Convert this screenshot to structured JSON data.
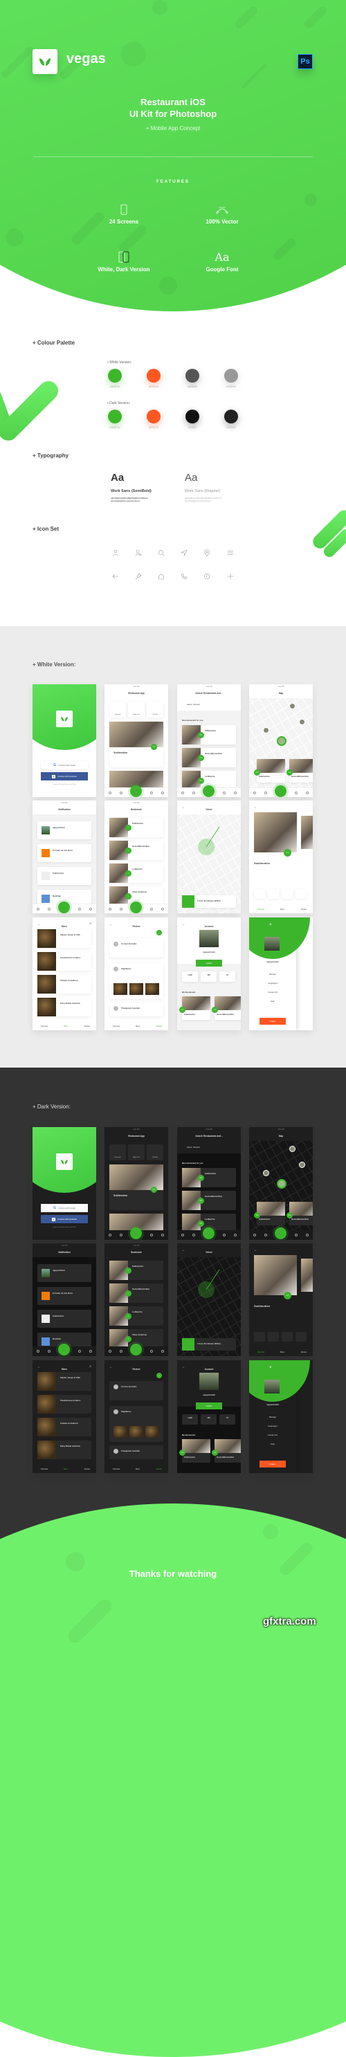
{
  "hero": {
    "brand_name": "vegas",
    "ps_badge": "Ps",
    "title_line1": "Restaurant iOS",
    "title_line2": "UI Kit for Photoshop",
    "subtitle": "+ Mobile App Concept",
    "features_label": "FEATURES",
    "features": [
      {
        "icon": "phone-icon",
        "label": "24 Screens"
      },
      {
        "icon": "vector-curve-icon",
        "label": "100% Vector"
      },
      {
        "icon": "dual-phone-icon",
        "label": "White, Dark Version"
      },
      {
        "icon": "font-icon",
        "label": "Google Font",
        "glyph": "Aa"
      }
    ]
  },
  "palette": {
    "title": "+ Colour Palette",
    "white_label": "• White Version:",
    "dark_label": "• Dark Version:",
    "white_colors": [
      "#3DB72A",
      "#FF5722",
      "#555555",
      "#999999"
    ],
    "dark_colors": [
      "#3DB72A",
      "#FF5722",
      "#111111",
      "#222222"
    ]
  },
  "typography": {
    "title": "+ Typography",
    "fonts": [
      {
        "sample": "Aa",
        "name": "Work Sans (SemiBold)",
        "upper": "ABCDEFGHIJKLMNOPQRSTUVWXYZ",
        "lower": "abcdefghijklmnopqrstuvwxyz"
      },
      {
        "sample": "Aa",
        "name": "Work Sans (Regular)",
        "upper": "ABCDEFGHIJKLMNOPQRSTUVWXYZ",
        "lower": "abcdefghijklmnopqrstuvwxyz"
      }
    ]
  },
  "icon_set": {
    "title": "+ Icon Set",
    "row1": [
      "user-icon",
      "user-settings-icon",
      "search-icon",
      "navigation-icon",
      "location-pin-icon",
      "menu-icon"
    ],
    "row2": [
      "back-arrow-icon",
      "pin-icon",
      "home-icon",
      "phone-call-icon",
      "clock-icon",
      "plus-icon"
    ]
  },
  "white_version": {
    "title": "+ White Version:",
    "screens": [
      {
        "title": "",
        "type": "login",
        "google": "Continue with Google",
        "facebook": "Continue with Facebook",
        "terms": "I agree to Privacy Policy and Terms"
      },
      {
        "title": "Restaurant App",
        "type": "home",
        "categories": [
          "Restaurant",
          "Coffee & Tea",
          "Club & Bar"
        ],
        "card_name": "Sublimotion",
        "rating": "4.2"
      },
      {
        "title": "Search Restaurants and...",
        "type": "search",
        "location": "Hanoi, Vietnam",
        "section": "Recommended for you",
        "items": [
          "Sublimotion",
          "HestonBlumenthal",
          "La Mascha"
        ]
      },
      {
        "title": "Map",
        "type": "map",
        "items": [
          "Sublimotion",
          "HestonBlumenthal"
        ]
      },
      {
        "title": "Notification",
        "type": "notification",
        "items": [
          "nguyenhnhdi",
          "El Celler de Can Roca",
          "Sublimotion",
          "RentSale"
        ]
      },
      {
        "title": "Bookmark",
        "type": "bookmark",
        "items": [
          "Sublimotion",
          "HestonBlumenthal",
          "La Mascha",
          "Vinas Undertow"
        ]
      },
      {
        "title": "Direct",
        "type": "direct",
        "eta": "1 hour 30 minutes (55km)"
      },
      {
        "title": "",
        "type": "detail",
        "name": "Sublimotion",
        "rating": "4.2",
        "tabs": [
          "Overview",
          "Menu",
          "Review"
        ]
      },
      {
        "title": "Menu",
        "type": "menu",
        "items": [
          "Salads, Soups & Chili",
          "Smokehouse Combos",
          "Chicken & Seafood",
          "Party Platter Add-Ons"
        ],
        "tabs": [
          "Overview",
          "Menu",
          "Review"
        ]
      },
      {
        "title": "Review",
        "type": "review",
        "items": [
          "Corona Australis",
          "Sagittarius",
          "Triangulum Australe"
        ],
        "tabs": [
          "Overview",
          "Menu",
          "Review"
        ]
      },
      {
        "title": "Account",
        "type": "account",
        "user": "nguyenhnhdi",
        "follow": "Follow",
        "stats": [
          "1,000",
          "100",
          "10"
        ],
        "section": "My Restaurant",
        "items": [
          "Sublimotion",
          "HestonBlumenthal"
        ]
      },
      {
        "title": "",
        "type": "drawer",
        "user": "nguyenhnhdi",
        "menu": [
          "Manage",
          "Languages",
          "Contact US",
          "Help"
        ],
        "logout": "Logout"
      }
    ]
  },
  "dark_version": {
    "title": "+ Dark Version:"
  },
  "footer": {
    "thanks": "Thanks for watching",
    "watermark": "gfxtra.com"
  }
}
